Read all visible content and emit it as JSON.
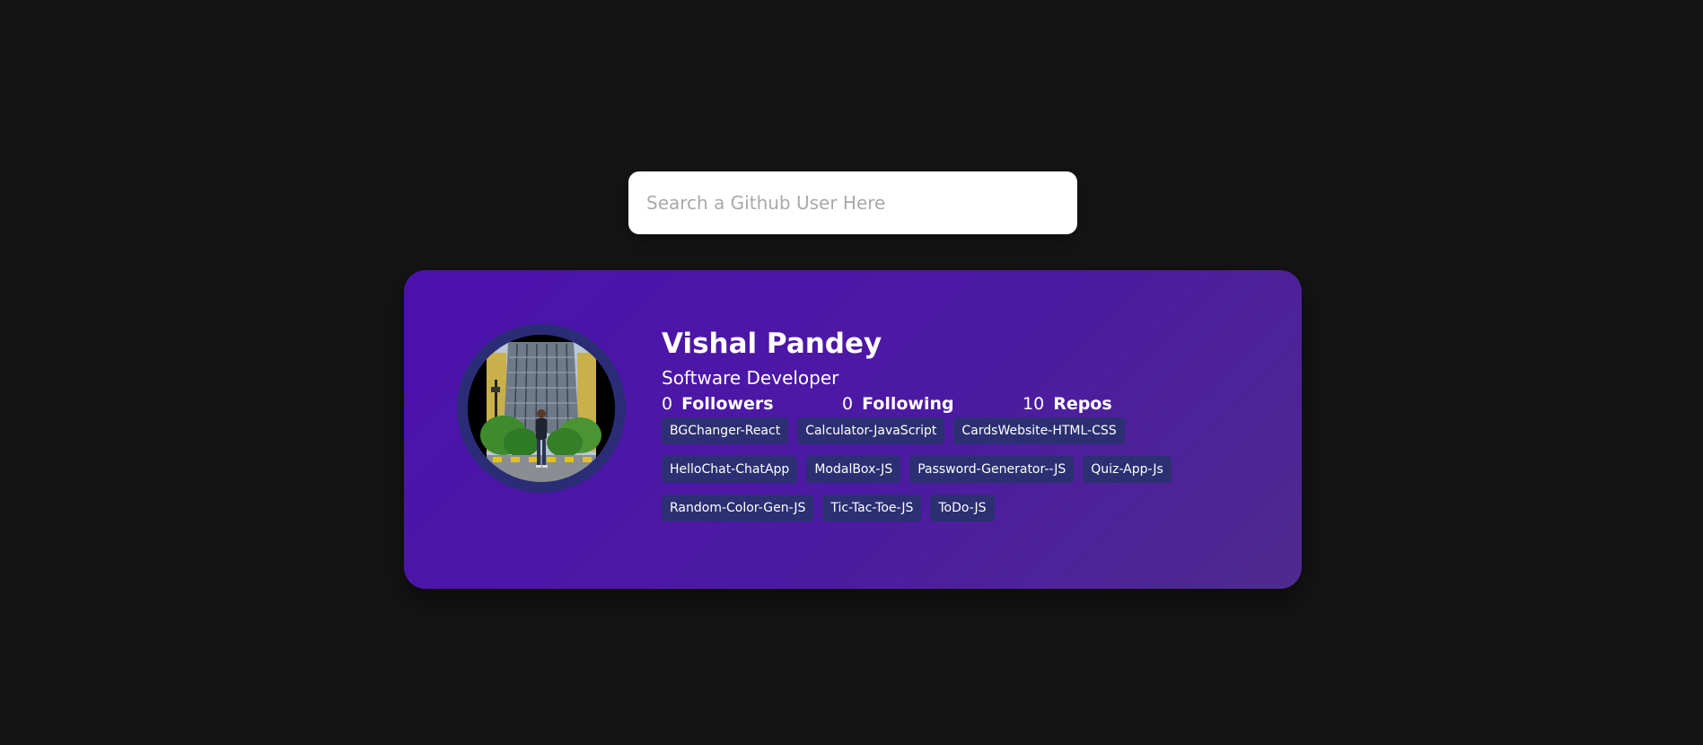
{
  "search": {
    "placeholder": "Search a Github User Here",
    "value": ""
  },
  "profile": {
    "name": "Vishal Pandey",
    "bio": "Software Developer",
    "stats": [
      {
        "value": "0",
        "label": "Followers"
      },
      {
        "value": "0",
        "label": "Following"
      },
      {
        "value": "10",
        "label": "Repos"
      }
    ],
    "repos": [
      "BGChanger-React",
      "Calculator-JavaScript",
      "CardsWebsite-HTML-CSS",
      "HelloChat-ChatApp",
      "ModalBox-JS",
      "Password-Generator--JS",
      "Quiz-App-Js",
      "Random-Color-Gen-JS",
      "Tic-Tac-Toe-JS",
      "ToDo-JS"
    ]
  },
  "colors": {
    "background": "#141414",
    "card_gradient_start": "#4b11ad",
    "card_gradient_end": "#4f2a8e",
    "repo_tag": "#2c2f72",
    "avatar_ring": "#2a2c75"
  }
}
